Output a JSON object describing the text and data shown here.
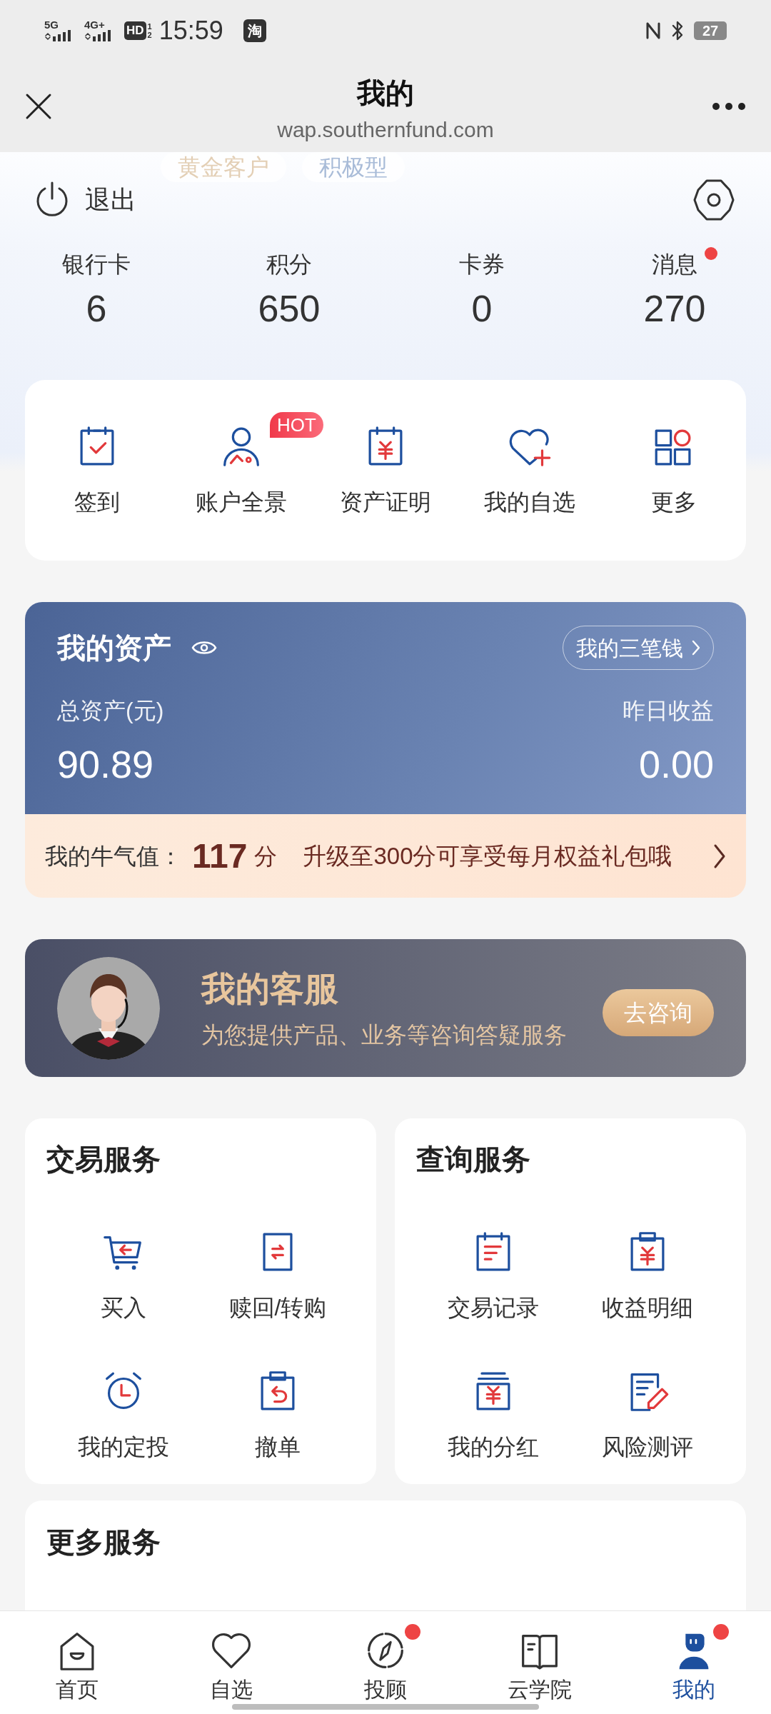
{
  "status_bar": {
    "signals": [
      "5G",
      "4G+"
    ],
    "hd": "HD",
    "hd_slots": [
      "1",
      "2"
    ],
    "time": "15:59",
    "app_badge": "淘",
    "battery": "27"
  },
  "header": {
    "title": "我的",
    "url": "wap.southernfund.com"
  },
  "profile": {
    "tags": [
      "黄金客户",
      "积极型"
    ],
    "logout": "退出"
  },
  "stats": [
    {
      "label": "银行卡",
      "value": "6",
      "dot": false
    },
    {
      "label": "积分",
      "value": "650",
      "dot": false
    },
    {
      "label": "卡券",
      "value": "0",
      "dot": false
    },
    {
      "label": "消息",
      "value": "270",
      "dot": true
    }
  ],
  "shortcuts": [
    {
      "label": "签到"
    },
    {
      "label": "账户全景",
      "badge": "HOT"
    },
    {
      "label": "资产证明"
    },
    {
      "label": "我的自选"
    },
    {
      "label": "更多"
    }
  ],
  "assets": {
    "title": "我的资产",
    "link": "我的三笔钱",
    "total_label": "总资产(元)",
    "total": "90.89",
    "yesterday_label": "昨日收益",
    "yesterday": "0.00",
    "bull": {
      "label": "我的牛气值：",
      "score": "117",
      "unit": "分",
      "promo": "升级至300分可享受每月权益礼包哦"
    }
  },
  "service": {
    "title": "我的客服",
    "subtitle": "为您提供产品、业务等咨询答疑服务",
    "button": "去咨询"
  },
  "panels": [
    {
      "title": "交易服务",
      "items": [
        {
          "label": "买入"
        },
        {
          "label": "赎回/转购"
        },
        {
          "label": "我的定投"
        },
        {
          "label": "撤单"
        }
      ]
    },
    {
      "title": "查询服务",
      "items": [
        {
          "label": "交易记录"
        },
        {
          "label": "收益明细"
        },
        {
          "label": "我的分红"
        },
        {
          "label": "风险测评"
        }
      ]
    }
  ],
  "more": {
    "title": "更多服务"
  },
  "nav": [
    {
      "label": "首页",
      "selected": false,
      "dot": false
    },
    {
      "label": "自选",
      "selected": false,
      "dot": false
    },
    {
      "label": "投顾",
      "selected": false,
      "dot": true
    },
    {
      "label": "云学院",
      "selected": false,
      "dot": false
    },
    {
      "label": "我的",
      "selected": true,
      "dot": true
    }
  ]
}
